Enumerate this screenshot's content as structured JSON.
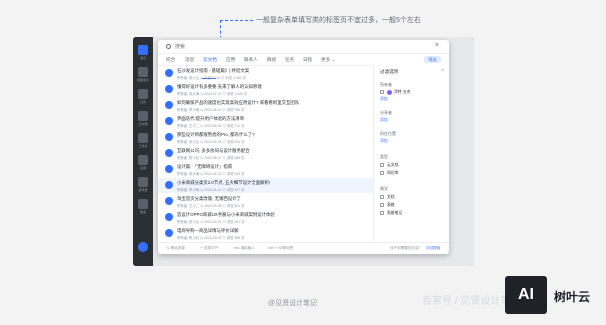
{
  "annotation": {
    "text": "一般复杂表单填写类的标签页不宜过多，一般5个左右"
  },
  "sidebar": {
    "labels": [
      "消息",
      "视频会议",
      "日历",
      "云文档",
      "工作台",
      "应用",
      "通讯录",
      "更多"
    ]
  },
  "search": {
    "placeholder": "搜索"
  },
  "tabs": [
    "综合",
    "消息",
    "云文档",
    "应用",
    "联系人",
    "群组",
    "任务",
    "日程",
    "更多 ⌄"
  ],
  "filter_button": "筛选",
  "results": [
    {
      "title": "石沙发设计指南 - 基础篇》| 终结文案",
      "meta": "所有者: 张小云   ◷ 今日 11:26   ⊙ 浏览 2,481 次"
    },
    {
      "title": "懂得好设计有多重要,先来了解人的认知原理",
      "meta": "所有者: 张大海   ◷ 2023-07-21   ⊙ 浏览 1,026 次"
    },
    {
      "title": "如何确保产品的速度也实现高效应用设计? 来看看阿里交互团队",
      "meta": "所有者: 李小明   ◷ 2023-06-12   ⊙ 浏览 938 次"
    },
    {
      "title": "界面迭代:提升用户体验的方法清单",
      "meta": "所有者: 王小二   ◷ 2023-05-30   ⊙ 浏览 712 次"
    },
    {
      "title": "那些设计师都很熟悉的Pro, 都有什么了?",
      "meta": "所有者: 张小云   ◷ 2023-05-18   ⊙ 浏览 604 次"
    },
    {
      "title": "互联网公司, 多多协同与设计服务配合",
      "meta": "所有者: 陈小红   ◷ 2023-05-02   ⊙ 浏览 588 次"
    },
    {
      "title": "设计篇: 「无障碍设计」指南",
      "meta": "所有者: 张大海   ◷ 2023-04-21   ⊙ 浏览 523 次"
    },
    {
      "title": "小米商城分类页2.0节点, 五大细节设计全面解析!",
      "meta": "所有者: 李小明   ◷ 2023-04-10   ⊙ 浏览 497 次"
    },
    {
      "title": "淘宝首页分类改版, 无锡西设计了",
      "meta": "所有者: 王小二   ◷ 2023-03-28   ⊙ 浏览 451 次"
    },
    {
      "title": "造设计OPPO商城UX手册与小米商城案例设计体验",
      "meta": "所有者: 张小云   ◷ 2023-03-15   ⊙ 浏览 402 次"
    },
    {
      "title": "电商导购—商品详情与评价详解",
      "meta": "所有者: 陈小红   ◷ 2023-03-02   ⊙ 浏览 388 次"
    }
  ],
  "footer": {
    "items": [
      "⇅ 移动选择",
      "↵ 选择打开",
      "esc 清除输入",
      "ctrl+⇥ 切换标签"
    ],
    "link_hint": "找不到需要的内容?",
    "link": "试试搜索"
  },
  "filter_panel": {
    "title": "过滤选项",
    "owner_label": "所有者",
    "owner_value": "涂特·五杰",
    "owner_add": "添加",
    "shared_label": "分享者",
    "shared_add": "添加",
    "location_label": "所在位置",
    "location_add": "添加",
    "type_label": "类型",
    "type_opts": [
      "云文档",
      "知识库"
    ],
    "format_label": "格式",
    "format_opts": [
      "文档",
      "表格",
      "思维笔记"
    ]
  },
  "caption": "@见贤设计笔记",
  "watermark": "百家号 / 见贤设计笔记",
  "logo": {
    "mark": "AI",
    "text": "树叶云"
  }
}
